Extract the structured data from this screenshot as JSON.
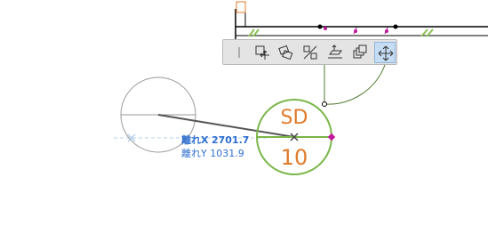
{
  "marker": {
    "top_text": "SD",
    "bottom_text": "10"
  },
  "tracker": {
    "dx_label": "離れX",
    "dx_value": "2701.7",
    "dy_label": "離れY",
    "dy_value": "1031.9"
  },
  "pet_palette": {
    "active_index": 7,
    "buttons": [
      {
        "icon": "separator-icon"
      },
      {
        "icon": "drag-copy-icon"
      },
      {
        "icon": "rotate-copy-icon"
      },
      {
        "icon": "mirror-icon"
      },
      {
        "icon": "elevate-icon"
      },
      {
        "icon": "multiply-icon"
      },
      {
        "icon": "move-icon"
      }
    ]
  },
  "colors": {
    "wall": "#000000",
    "hatch": "#8cc152",
    "marker_circle": "#7ab648",
    "marker_text": "#e07b2b",
    "guide": "#b5d0ee",
    "tracker_text": "#2f6fd0",
    "node": "#c0189a"
  }
}
